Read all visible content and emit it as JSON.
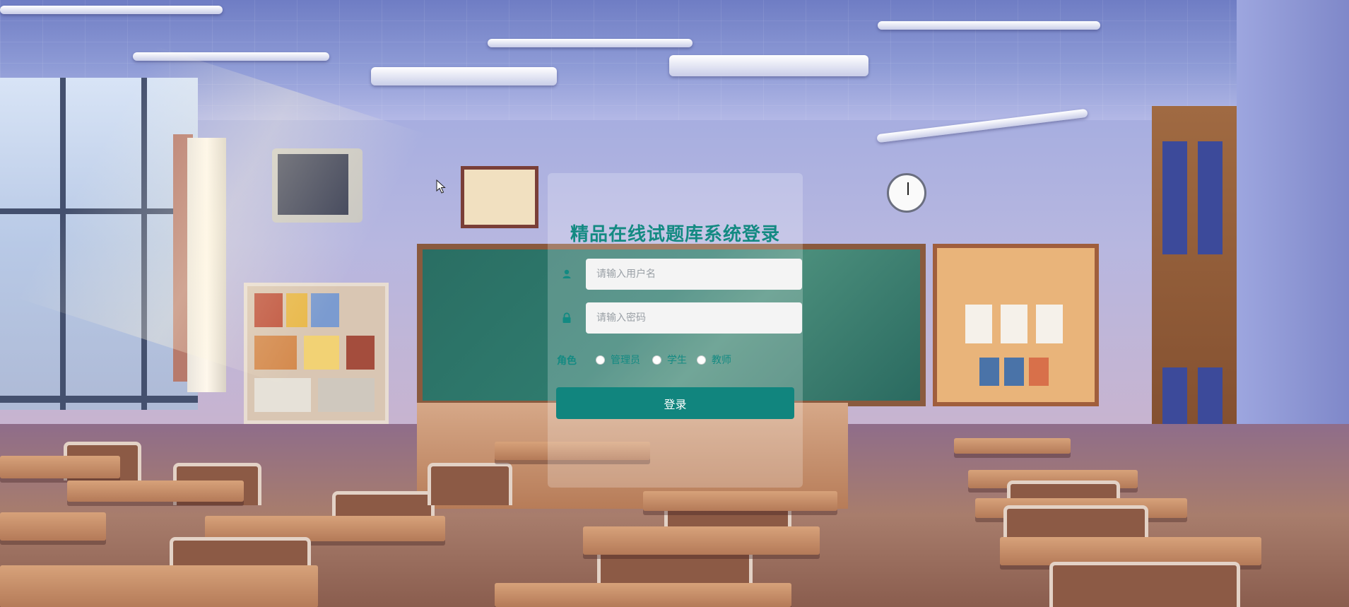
{
  "login": {
    "title": "精品在线试题库系统登录",
    "username": {
      "placeholder": "请输入用户名",
      "value": "",
      "icon": "user-icon"
    },
    "password": {
      "placeholder": "请输入密码",
      "value": "",
      "icon": "lock-icon"
    },
    "role": {
      "label": "角色",
      "options": [
        "管理员",
        "学生",
        "教师"
      ],
      "selected": null
    },
    "submit_label": "登录"
  },
  "theme": {
    "accent": "#11857e",
    "title_color": "#138a82",
    "background": "classroom-illustration"
  }
}
